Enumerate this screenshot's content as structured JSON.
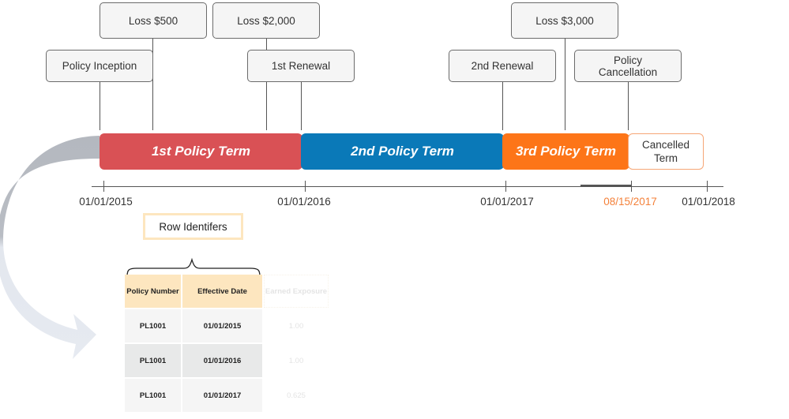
{
  "callouts": {
    "loss_1": "Loss $500",
    "loss_2": "Loss $2,000",
    "loss_3": "Loss $3,000",
    "inception": "Policy Inception",
    "renewal_1": "1st Renewal",
    "renewal_2": "2nd Renewal",
    "cancellation": "Policy Cancellation"
  },
  "terms": [
    {
      "label": "1st Policy Term",
      "color": "#d95155"
    },
    {
      "label": "2nd Policy Term",
      "color": "#0a79b8"
    },
    {
      "label": "3rd Policy Term",
      "color": "#fd7518"
    },
    {
      "label": "Cancelled Term",
      "color": "#ffffff",
      "border": "#f6a676"
    }
  ],
  "axis_dates": [
    {
      "label": "01/01/2015",
      "color": "#333333"
    },
    {
      "label": "01/01/2016",
      "color": "#333333"
    },
    {
      "label": "01/01/2017",
      "color": "#333333"
    },
    {
      "label": "08/15/2017",
      "color": "#f4813a"
    },
    {
      "label": "01/01/2018",
      "color": "#333333"
    }
  ],
  "row_identifiers_label": "Row Identifers",
  "table": {
    "headers": [
      "Policy Number",
      "Effective Date",
      "Earned Exposure"
    ],
    "rows": [
      [
        "PL1001",
        "01/01/2015",
        "1.00"
      ],
      [
        "PL1001",
        "01/01/2016",
        "1.00"
      ],
      [
        "PL1001",
        "01/01/2017",
        "0.625"
      ]
    ]
  }
}
